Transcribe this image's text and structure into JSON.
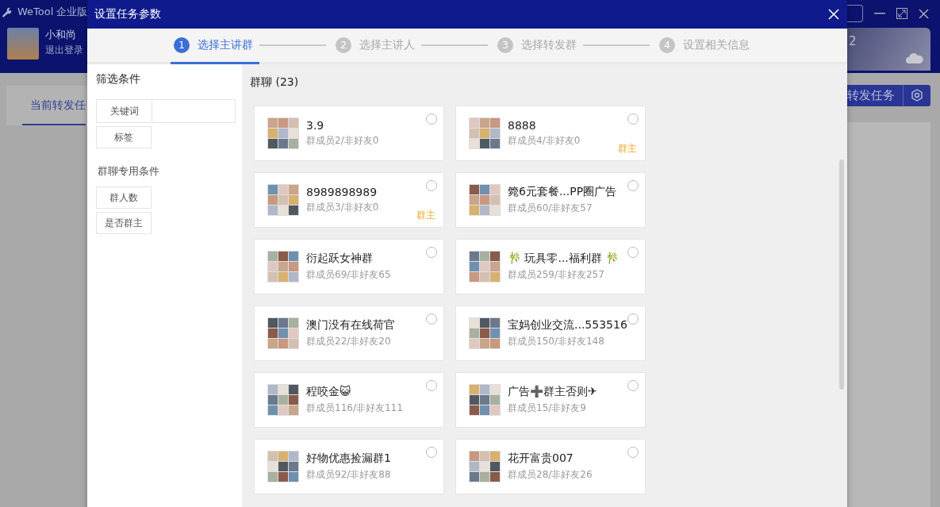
{
  "app": {
    "title": "WeTool 企业版",
    "user": {
      "name": "小和尚",
      "logout": "退出登录"
    },
    "tab": "当前转发任",
    "profile_text": "2",
    "action_button": "转发任务"
  },
  "dialog": {
    "title": "设置任务参数",
    "steps": [
      {
        "number": "1",
        "label": "选择主讲群",
        "selected": true
      },
      {
        "number": "2",
        "label": "选择主讲人",
        "selected": false
      },
      {
        "number": "3",
        "label": "选择转发群",
        "selected": false
      },
      {
        "number": "4",
        "label": "设置相关信息",
        "selected": false
      }
    ],
    "filters": {
      "title": "筛选条件",
      "keyword_label": "关键词",
      "tag": "标签",
      "group_title": "群聊专用条件",
      "group_filters": [
        "群人数",
        "是否群主"
      ]
    },
    "list": {
      "title": "群聊 (23)",
      "groups": [
        {
          "name": "3.9",
          "stats": "群成员2/非好友0",
          "selected": false
        },
        {
          "name": "8888",
          "stats": "群成员4/非好友0",
          "badge": "群主",
          "selected": false
        },
        {
          "name": "8989898989",
          "stats": "群成员3/非好友0",
          "badge": "群主",
          "selected": false
        },
        {
          "name": "箢6元套餐...PP圈广告",
          "stats": "群成员60/非好友57",
          "selected": false
        },
        {
          "name": "衍起跃女神群",
          "stats": "群成员69/非好友65",
          "selected": false
        },
        {
          "name": "🎋 玩具零...福利群 🎋",
          "stats": "群成员259/非好友257",
          "selected": false
        },
        {
          "name": "澳门没有在线荷官",
          "stats": "群成员22/非好友20",
          "selected": false
        },
        {
          "name": "宝妈创业交流...553516",
          "stats": "群成员150/非好友148",
          "selected": false
        },
        {
          "name": "程咬金😺",
          "stats": "群成员116/非好友111",
          "selected": false
        },
        {
          "name": "广告➕群主否则✈",
          "stats": "群成员15/非好友9",
          "selected": false
        },
        {
          "name": "好物优惠捡漏群1",
          "stats": "群成员92/非好友88",
          "selected": false
        },
        {
          "name": "花开富贵007",
          "stats": "群成员28/非好友26",
          "selected": false
        }
      ]
    }
  }
}
